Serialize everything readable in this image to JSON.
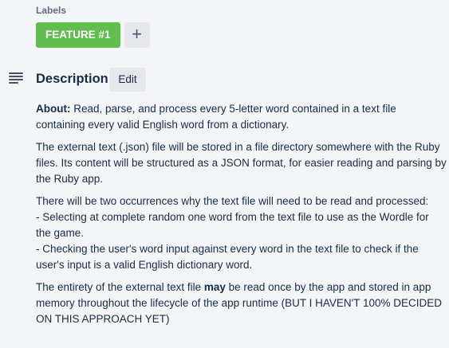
{
  "labels": {
    "heading": "Labels",
    "items": [
      {
        "text": "FEATURE #1",
        "color": "#61bd4f"
      }
    ],
    "add_symbol": "+"
  },
  "description": {
    "icon": "description-lines-icon",
    "title": "Description",
    "edit_label": "Edit",
    "paragraphs": {
      "p1_bold": "About:",
      "p1_text": " Read, parse, and process every 5-letter word contained in a text file containing every valid English word from a dictionary.",
      "p2_text": "The external text (.json) file will be stored in a file directory somewhere with the Ruby files. Its content will be structured as a JSON format, for easier reading and parsing by the Ruby app.",
      "p3_line1": "There will be two occurrences why the text file will need to be read and processed:",
      "p3_line2": "- Selecting at complete random one word from the text file to use as the Wordle for the game.",
      "p3_line3": "- Checking the user's word input against every word in the text file to check if the user's input is a valid English dictionary word.",
      "p4_before": "The entirety of the external text file ",
      "p4_bold": "may",
      "p4_after": " be read once by the app and stored in app memory throughout the lifecycle of the app runtime (BUT I HAVEN'T 100% DECIDED ON THIS APPROACH YET)"
    }
  }
}
